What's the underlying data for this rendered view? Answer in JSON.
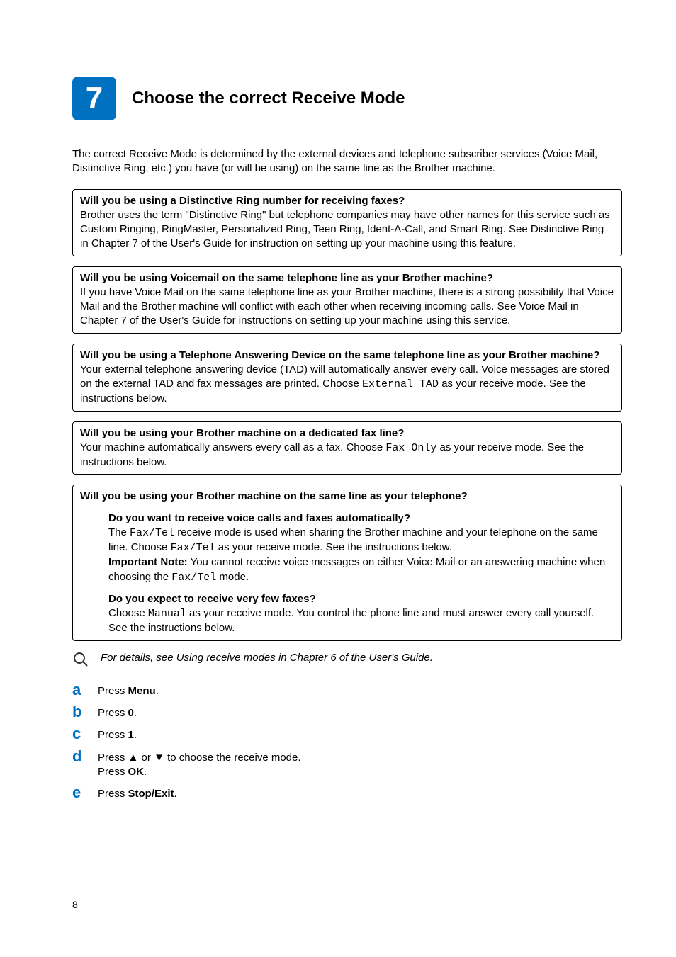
{
  "header": {
    "step_number": "7",
    "title": "Choose the correct Receive Mode"
  },
  "intro": "The correct Receive Mode is determined by the external devices and telephone subscriber services (Voice Mail, Distinctive Ring, etc.) you have (or will be using) on the same line as the Brother machine.",
  "box1": {
    "q": "Will you be using a Distinctive Ring number for receiving faxes?",
    "body": "Brother uses the term \"Distinctive Ring\" but telephone companies may have other names for this service such as Custom Ringing, RingMaster, Personalized Ring, Teen Ring, Ident-A-Call, and Smart Ring. See Distinctive Ring in Chapter 7 of the User's Guide for instruction on setting up your machine using this feature."
  },
  "box2": {
    "q": "Will you be using Voicemail on the same telephone line as your Brother machine?",
    "body": "If you have Voice Mail on the same telephone line as your Brother machine, there is a strong possibility that Voice Mail and the Brother machine will conflict with each other when receiving incoming calls. See Voice Mail in Chapter 7 of the User's Guide for instructions on setting up your machine using this service."
  },
  "box3": {
    "q": "Will you be using a Telephone Answering Device on the same telephone line as your Brother machine?",
    "b1": "Your external telephone answering device (TAD) will automatically answer every call. Voice messages are stored on the external TAD and fax messages are printed. Choose ",
    "code": "External TAD",
    "b2": " as your receive mode. See the instructions below."
  },
  "box4": {
    "q": "Will you be using your Brother machine on a dedicated fax line?",
    "b1": "Your machine automatically answers every call as a fax. Choose ",
    "code": "Fax Only",
    "b2": " as your receive mode. See the instructions below."
  },
  "box5": {
    "q": "Will you be using your Brother machine on the same line as your telephone?",
    "sub1": {
      "q": "Do you want to receive voice calls and faxes automatically?",
      "l1a": "The ",
      "l1code": "Fax/Tel",
      "l1b": " receive mode is used when sharing the Brother machine and your telephone on the same line. Choose ",
      "l1code2": "Fax/Tel",
      "l1c": " as your receive mode. See the instructions below.",
      "l2label": "Important Note:",
      "l2a": " You cannot receive voice messages on either Voice Mail or an answering machine when choosing the ",
      "l2code": "Fax/Tel",
      "l2b": " mode."
    },
    "sub2": {
      "q": "Do you expect to receive very few faxes?",
      "b1": "Choose ",
      "code": "Manual",
      "b2": " as your receive mode. You control the phone line and must answer every call yourself. See the instructions below."
    }
  },
  "note": "For details, see Using receive modes in Chapter 6 of the User's Guide.",
  "steps": {
    "a": {
      "letter": "a",
      "t1": "Press ",
      "bold": "Menu",
      "t2": "."
    },
    "b": {
      "letter": "b",
      "t1": "Press ",
      "bold": "0",
      "t2": "."
    },
    "c": {
      "letter": "c",
      "t1": "Press ",
      "bold": "1",
      "t2": "."
    },
    "d": {
      "letter": "d",
      "line1a": "Press ",
      "up": "▲",
      "mid": " or ",
      "down": "▼",
      "line1b": " to choose the receive mode.",
      "line2a": "Press ",
      "ok": "OK",
      "line2b": "."
    },
    "e": {
      "letter": "e",
      "t1": "Press ",
      "bold": "Stop/Exit",
      "t2": "."
    }
  },
  "page_number": "8"
}
